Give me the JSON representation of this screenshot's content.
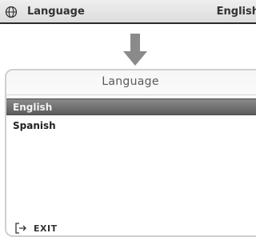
{
  "top_row": {
    "label": "Language",
    "value": "English",
    "icon": "globe-icon"
  },
  "arrow": {
    "icon": "down-arrow-icon",
    "color": "#8a8a8a"
  },
  "dialog": {
    "title": "Language",
    "options": [
      {
        "label": "English",
        "selected": true
      },
      {
        "label": "Spanish",
        "selected": false
      }
    ],
    "exit_label": "EXIT",
    "exit_icon": "exit-icon"
  }
}
